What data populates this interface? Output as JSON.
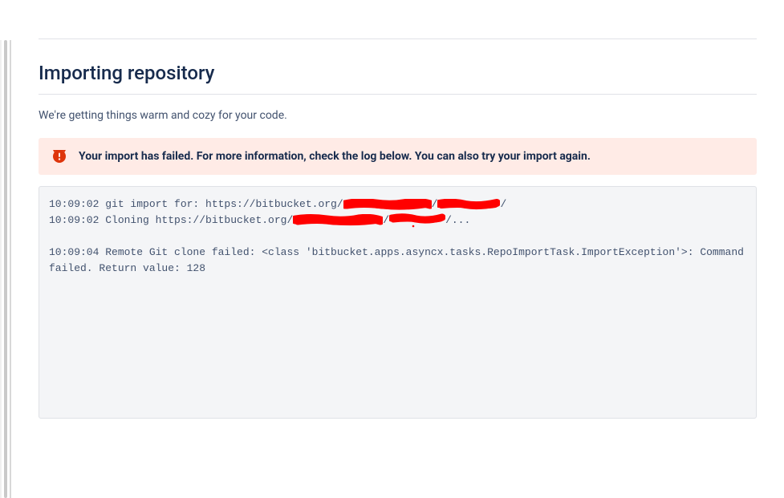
{
  "page": {
    "title": "Importing repository",
    "subtitle": "We're getting things warm and cozy for your code."
  },
  "alert": {
    "message": "Your import has failed. For more information, check the log below. You can also try your import again."
  },
  "log": {
    "line1_pre": "10:09:02 git import for: https://bitbucket.org/",
    "line1_mid": "/",
    "line1_post": "/",
    "line2_pre": "10:09:02 Cloning https://bitbucket.org/",
    "line2_mid": "/",
    "line2_post": "/...",
    "line3": "10:09:04 Remote Git clone failed: <class 'bitbucket.apps.asyncx.tasks.RepoImportTask.ImportException'>: Command failed. Return value: 128"
  }
}
